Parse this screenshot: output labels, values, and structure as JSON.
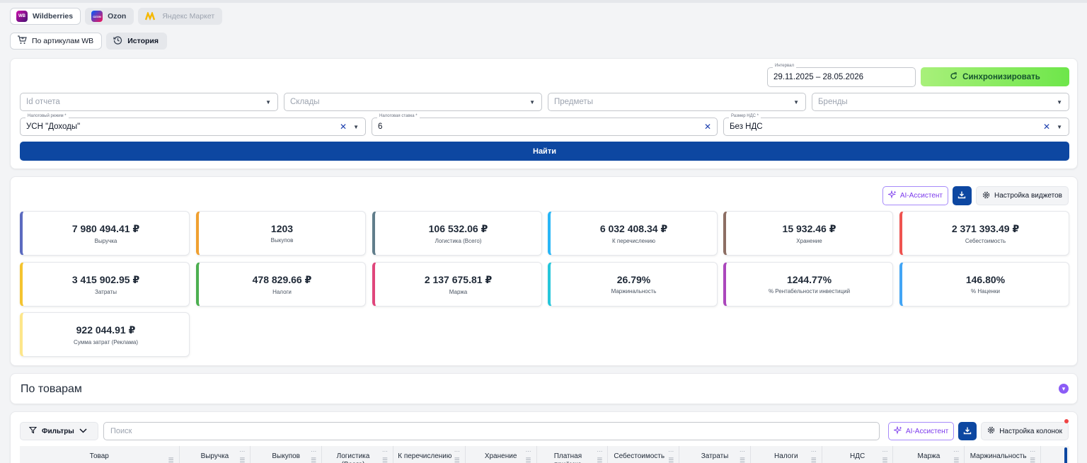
{
  "marketplaces": [
    {
      "label": "Wildberries",
      "logo": "WB",
      "state": "active"
    },
    {
      "label": "Ozon",
      "logo": "OZON",
      "state": "normal"
    },
    {
      "label": "Яндекс Маркет",
      "logo": "yandex-market-logo",
      "state": "disabled"
    }
  ],
  "views": [
    {
      "label": "По артикулам WB",
      "icon": "cart-icon"
    },
    {
      "label": "История",
      "icon": "history-icon"
    }
  ],
  "filters": {
    "interval_label": "Интервал",
    "interval_value": "29.11.2025 – 28.05.2026",
    "sync_label": "Синхронизировать",
    "report_id_placeholder": "Id отчета",
    "warehouses_placeholder": "Склады",
    "subjects_placeholder": "Предметы",
    "brands_placeholder": "Бренды",
    "tax_regime_label": "Налоговый режим *",
    "tax_regime_value": "УСН \"Доходы\"",
    "tax_rate_label": "Налоговая ставка *",
    "tax_rate_value": "6",
    "vat_label": "Размер НДС *",
    "vat_value": "Без НДС",
    "find_label": "Найти"
  },
  "widgets_toolbar": {
    "ai_label": "AI-Ассистент",
    "settings_label": "Настройка виджетов"
  },
  "metrics": [
    {
      "value": "7 980 494.41 ₽",
      "label": "Выручка",
      "color": "#5c6bc0"
    },
    {
      "value": "1203",
      "label": "Выкупов",
      "color": "#f0a030"
    },
    {
      "value": "106 532.06 ₽",
      "label": "Логистика (Всего)",
      "color": "#607d8b"
    },
    {
      "value": "6 032 408.34 ₽",
      "label": "К перечислению",
      "color": "#29b6f6"
    },
    {
      "value": "15 932.46 ₽",
      "label": "Хранение",
      "color": "#8d6e63"
    },
    {
      "value": "2 371 393.49 ₽",
      "label": "Себестоимость",
      "color": "#ef5350"
    },
    {
      "value": "3 415 902.95 ₽",
      "label": "Затраты",
      "color": "#f4c430"
    },
    {
      "value": "478 829.66 ₽",
      "label": "Налоги",
      "color": "#4caf50"
    },
    {
      "value": "2 137 675.81 ₽",
      "label": "Маржа",
      "color": "#e0457b"
    },
    {
      "value": "26.79%",
      "label": "Маржинальность",
      "color": "#26c6da"
    },
    {
      "value": "1244.77%",
      "label": "% Рентабельности инвестиций",
      "color": "#ab47bc"
    },
    {
      "value": "146.80%",
      "label": "% Наценки",
      "color": "#42a5f5"
    },
    {
      "value": "922 044.91 ₽",
      "label": "Сумма затрат (Реклама)",
      "color": "#fde68a"
    }
  ],
  "products": {
    "title": "По товарам"
  },
  "table": {
    "filters_label": "Фильтры",
    "search_placeholder": "Поиск",
    "ai_label": "AI-Ассистент",
    "columns_settings_label": "Настройка колонок",
    "columns": [
      {
        "label": "Товар"
      },
      {
        "label": "Выручка"
      },
      {
        "label": "Выкупов"
      },
      {
        "label": "Логистика (Всего)"
      },
      {
        "label": "К перечислению"
      },
      {
        "label": "Хранение"
      },
      {
        "label": "Платная приёмка"
      },
      {
        "label": "Себестоимость"
      },
      {
        "label": "Затраты"
      },
      {
        "label": "Налоги"
      },
      {
        "label": "НДС"
      },
      {
        "label": "Маржа"
      },
      {
        "label": "Маржинальность"
      }
    ]
  }
}
